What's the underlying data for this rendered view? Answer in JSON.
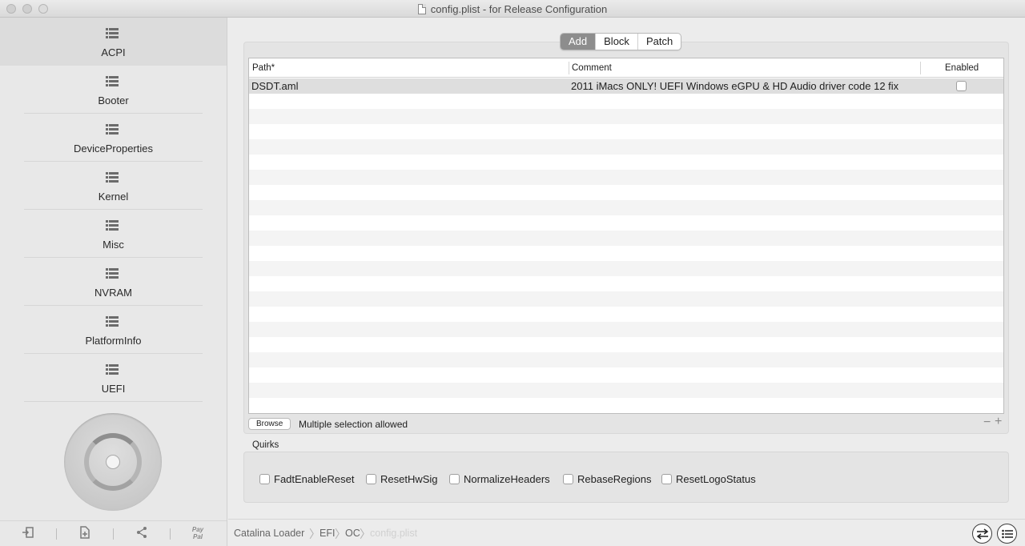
{
  "window": {
    "title": "config.plist - for Release Configuration"
  },
  "sidebar": {
    "items": [
      {
        "label": "ACPI",
        "active": true
      },
      {
        "label": "Booter"
      },
      {
        "label": "DeviceProperties"
      },
      {
        "label": "Kernel"
      },
      {
        "label": "Misc"
      },
      {
        "label": "NVRAM"
      },
      {
        "label": "PlatformInfo"
      },
      {
        "label": "UEFI"
      }
    ],
    "bottom": {
      "paypal_line1": "Pay",
      "paypal_line2": "Pal"
    }
  },
  "tabs": [
    {
      "label": "Add",
      "active": true
    },
    {
      "label": "Block"
    },
    {
      "label": "Patch"
    }
  ],
  "table": {
    "columns": {
      "path": "Path*",
      "comment": "Comment",
      "enabled": "Enabled"
    },
    "rows": [
      {
        "path": "DSDT.aml",
        "comment": "2011 iMacs ONLY!  UEFI Windows eGPU & HD Audio driver code 12 fix",
        "enabled": false
      }
    ]
  },
  "footer": {
    "browse_label": "Browse",
    "note": "Multiple selection allowed",
    "minus": "−",
    "plus": "+"
  },
  "quirks": {
    "label": "Quirks",
    "items": [
      {
        "label": "FadtEnableReset",
        "checked": false
      },
      {
        "label": "ResetHwSig",
        "checked": false
      },
      {
        "label": "NormalizeHeaders",
        "checked": false
      },
      {
        "label": "RebaseRegions",
        "checked": false
      },
      {
        "label": "ResetLogoStatus",
        "checked": false
      }
    ]
  },
  "pathbar": {
    "crumbs": [
      "Catalina Loader",
      "EFI",
      "OC",
      "config.plist"
    ]
  }
}
